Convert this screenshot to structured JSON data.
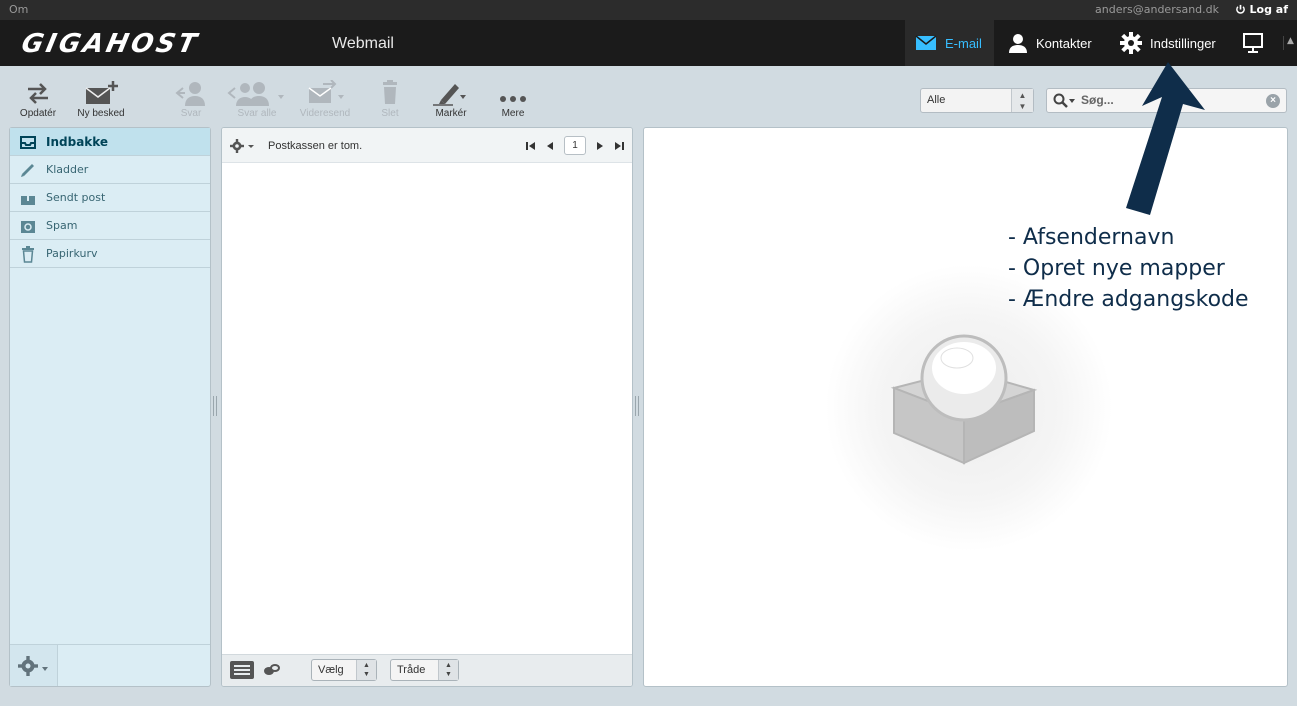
{
  "topline": {
    "about": "Om",
    "user": "anders@andersand.dk",
    "logout": "Log af"
  },
  "header": {
    "logo": "GIGAHOST",
    "app_name": "Webmail",
    "nav": [
      {
        "label": "E-mail",
        "icon": "envelope-icon",
        "active": true
      },
      {
        "label": "Kontakter",
        "icon": "person-icon",
        "active": false
      },
      {
        "label": "Indstillinger",
        "icon": "gear-icon",
        "active": false
      },
      {
        "label": "",
        "icon": "monitor-icon",
        "active": false
      }
    ]
  },
  "toolbar": {
    "refresh": "Opdatér",
    "compose": "Ny besked",
    "reply": "Svar",
    "reply_all": "Svar alle",
    "forward": "Videresend",
    "delete": "Slet",
    "mark": "Markér",
    "more": "Mere",
    "filter_value": "Alle",
    "search_placeholder": "Søg..."
  },
  "folders": [
    {
      "label": "Indbakke",
      "icon": "inbox-icon",
      "selected": true
    },
    {
      "label": "Kladder",
      "icon": "pencil-icon",
      "selected": false
    },
    {
      "label": "Sendt post",
      "icon": "sent-icon",
      "selected": false
    },
    {
      "label": "Spam",
      "icon": "spam-icon",
      "selected": false
    },
    {
      "label": "Papirkurv",
      "icon": "trash-icon",
      "selected": false
    }
  ],
  "message_list": {
    "empty_text": "Postkassen er tom.",
    "page": "1",
    "select_label": "Vælg",
    "thread_label": "Tråde"
  },
  "annotation": {
    "lines": [
      "- Afsendernavn",
      "- Opret nye mapper",
      "- Ændre adgangskode"
    ]
  },
  "colors": {
    "accent": "#37beff",
    "header_bg": "#1b1b1b",
    "folder_bg": "#dbedf4",
    "annotation": "#0f2d4a"
  }
}
